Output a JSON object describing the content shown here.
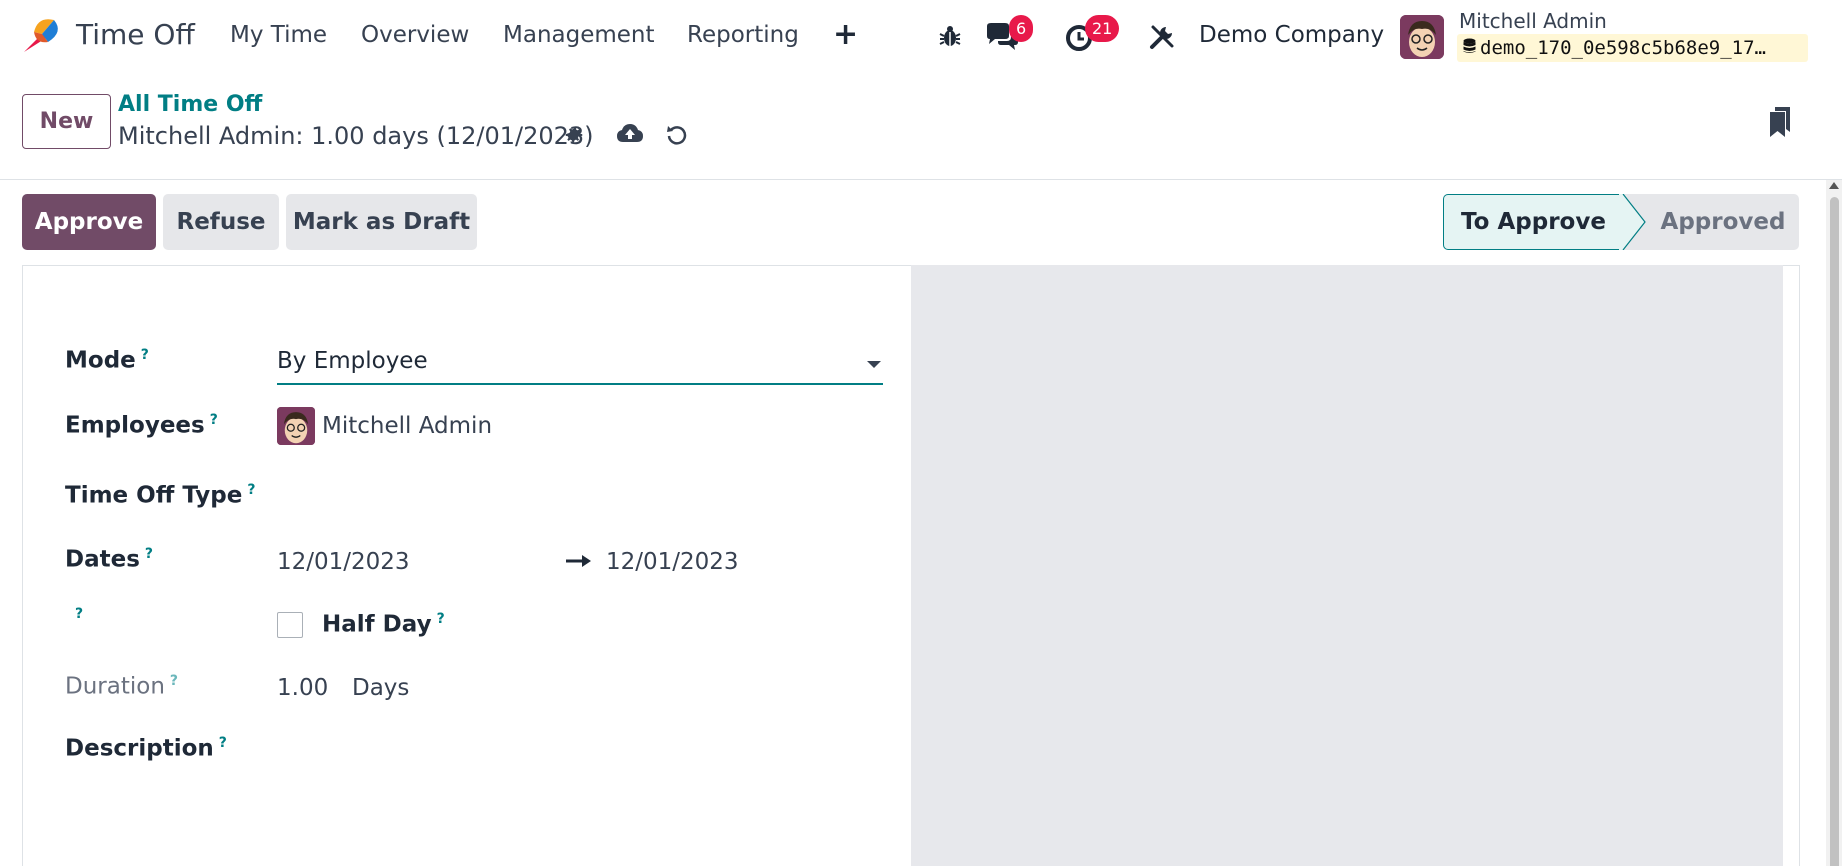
{
  "app": {
    "name": "Time Off",
    "logo_icon": "time-off-app-icon"
  },
  "nav": {
    "menu": [
      "My Time",
      "Overview",
      "Management",
      "Reporting"
    ],
    "new_menu_icon": "plus-icon",
    "messages_badge": "6",
    "activities_badge": "21",
    "company": "Demo Company",
    "user": "Mitchell Admin",
    "database": "demo_170_0e598c5b68e9_17…",
    "database_icon": "database-icon"
  },
  "control_panel": {
    "new_label": "New",
    "breadcrumb": "All Time Off",
    "record_title": "Mitchell Admin: 1.00 days (12/01/2023)",
    "icons": [
      "gear-icon",
      "cloud-upload-icon",
      "undo-icon",
      "bookmark-icon"
    ]
  },
  "statusbar": {
    "buttons": {
      "approve": "Approve",
      "refuse": "Refuse",
      "draft": "Mark as Draft"
    },
    "stages": {
      "current": "To Approve",
      "next": "Approved"
    }
  },
  "form": {
    "mode": {
      "label": "Mode",
      "help": "?",
      "value": "By Employee"
    },
    "employees": {
      "label": "Employees",
      "help": "?",
      "value": "Mitchell Admin"
    },
    "time_off_type": {
      "label": "Time Off Type",
      "help": "?",
      "value": ""
    },
    "dates": {
      "label": "Dates",
      "help": "?",
      "from": "12/01/2023",
      "to": "12/01/2023"
    },
    "half_day": {
      "help_only": "?",
      "label": "Half Day",
      "help": "?",
      "checked": false
    },
    "duration": {
      "label": "Duration",
      "help": "?",
      "value": "1.00",
      "unit": "Days"
    },
    "description": {
      "label": "Description",
      "help": "?",
      "value": ""
    }
  },
  "colors": {
    "brand": "#714b67",
    "accent": "#017e84",
    "badge": "#e8194a"
  }
}
